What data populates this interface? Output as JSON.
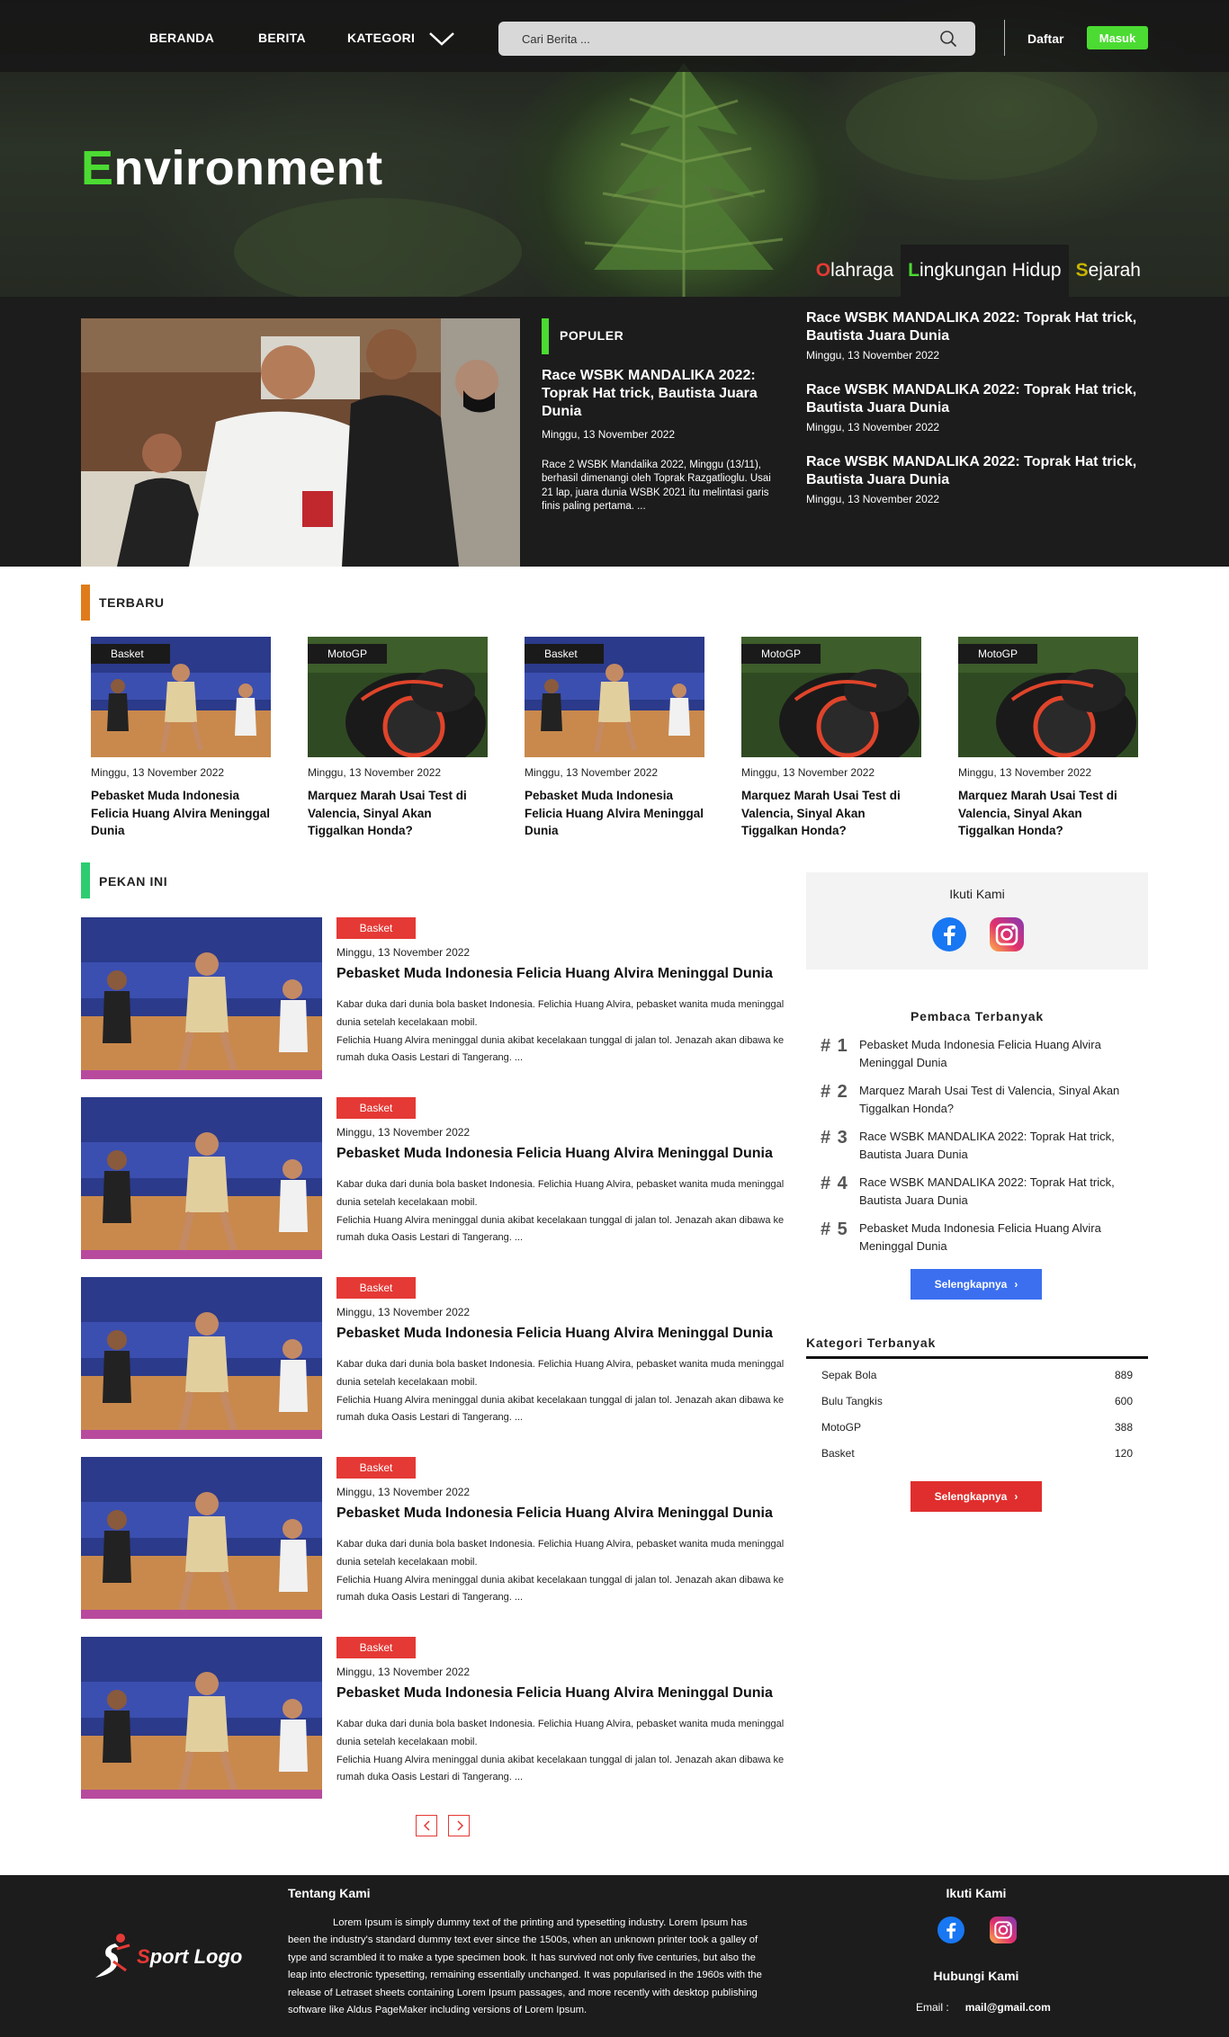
{
  "nav": {
    "home": "BERANDA",
    "news": "BERITA",
    "category": "KATEGORI",
    "search_placeholder": "Cari Berita ...",
    "register": "Daftar",
    "login": "Masuk"
  },
  "hero": {
    "title_first": "E",
    "title_rest": "nvironment",
    "tabs": [
      {
        "first": "O",
        "rest": "lahraga",
        "color": "#e53935"
      },
      {
        "first": "L",
        "rest": "ingkungan Hidup",
        "color": "#4bdb32"
      },
      {
        "first": "S",
        "rest": "ejarah",
        "color": "#c8b400"
      }
    ]
  },
  "popular": {
    "label": "POPULER",
    "title": "Race WSBK MANDALIKA 2022: Toprak Hat trick, Bautista Juara Dunia",
    "date": "Minggu, 13 November 2022",
    "excerpt": "Race 2 WSBK Mandalika 2022, Minggu (13/11), berhasil dimenangi oleh Toprak Razgatlioglu. Usai 21 lap, juara dunia WSBK 2021 itu melintasi garis finis paling pertama. ...",
    "side": [
      {
        "title": "Race WSBK MANDALIKA 2022: Toprak Hat trick, Bautista Juara Dunia",
        "date": "Minggu, 13 November 2022"
      },
      {
        "title": "Race WSBK MANDALIKA 2022: Toprak Hat trick, Bautista Juara Dunia",
        "date": "Minggu, 13 November 2022"
      },
      {
        "title": "Race WSBK MANDALIKA 2022: Toprak Hat trick, Bautista Juara Dunia",
        "date": "Minggu, 13 November 2022"
      }
    ]
  },
  "latest": {
    "label": "TERBARU",
    "cards": [
      {
        "badge": "Basket",
        "date": "Minggu, 13 November 2022",
        "title": "Pebasket Muda Indonesia Felicia Huang Alvira Meninggal Dunia"
      },
      {
        "badge": "MotoGP",
        "date": "Minggu, 13 November 2022",
        "title": "Marquez Marah Usai Test di Valencia, Sinyal Akan Tiggalkan Honda?"
      },
      {
        "badge": "Basket",
        "date": "Minggu, 13 November 2022",
        "title": "Pebasket Muda Indonesia Felicia Huang Alvira Meninggal Dunia"
      },
      {
        "badge": "MotoGP",
        "date": "Minggu, 13 November 2022",
        "title": "Marquez Marah Usai Test di Valencia, Sinyal Akan Tiggalkan Honda?"
      },
      {
        "badge": "MotoGP",
        "date": "Minggu, 13 November 2022",
        "title": "Marquez Marah Usai Test di Valencia, Sinyal Akan Tiggalkan Honda?"
      }
    ]
  },
  "week": {
    "label": "PEKAN INI",
    "items": [
      {
        "badge": "Basket",
        "date": "Minggu, 13 November 2022",
        "title": "Pebasket Muda Indonesia Felicia Huang Alvira Meninggal Dunia",
        "text1": "Kabar duka dari dunia bola basket Indonesia. Felichia Huang Alvira, pebasket wanita muda meninggal dunia setelah kecelakaan mobil.",
        "text2": "Felichia Huang Alvira meninggal dunia akibat kecelakaan tunggal di jalan tol. Jenazah akan dibawa ke rumah duka Oasis Lestari di Tangerang. ..."
      },
      {
        "badge": "Basket",
        "date": "Minggu, 13 November 2022",
        "title": "Pebasket Muda Indonesia Felicia Huang Alvira Meninggal Dunia",
        "text1": "Kabar duka dari dunia bola basket Indonesia. Felichia Huang Alvira, pebasket wanita muda meninggal dunia setelah kecelakaan mobil.",
        "text2": "Felichia Huang Alvira meninggal dunia akibat kecelakaan tunggal di jalan tol. Jenazah akan dibawa ke rumah duka Oasis Lestari di Tangerang. ..."
      },
      {
        "badge": "Basket",
        "date": "Minggu, 13 November 2022",
        "title": "Pebasket Muda Indonesia Felicia Huang Alvira Meninggal Dunia",
        "text1": "Kabar duka dari dunia bola basket Indonesia. Felichia Huang Alvira, pebasket wanita muda meninggal dunia setelah kecelakaan mobil.",
        "text2": "Felichia Huang Alvira meninggal dunia akibat kecelakaan tunggal di jalan tol. Jenazah akan dibawa ke rumah duka Oasis Lestari di Tangerang. ..."
      },
      {
        "badge": "Basket",
        "date": "Minggu, 13 November 2022",
        "title": "Pebasket Muda Indonesia Felicia Huang Alvira Meninggal Dunia",
        "text1": "Kabar duka dari dunia bola basket Indonesia. Felichia Huang Alvira, pebasket wanita muda meninggal dunia setelah kecelakaan mobil.",
        "text2": "Felichia Huang Alvira meninggal dunia akibat kecelakaan tunggal di jalan tol. Jenazah akan dibawa ke rumah duka Oasis Lestari di Tangerang. ..."
      },
      {
        "badge": "Basket",
        "date": "Minggu, 13 November 2022",
        "title": "Pebasket Muda Indonesia Felicia Huang Alvira Meninggal Dunia",
        "text1": "Kabar duka dari dunia bola basket Indonesia. Felichia Huang Alvira, pebasket wanita muda meninggal dunia setelah kecelakaan mobil.",
        "text2": "Felichia Huang Alvira meninggal dunia akibat kecelakaan tunggal di jalan tol. Jenazah akan dibawa ke rumah duka Oasis Lestari di Tangerang. ..."
      }
    ]
  },
  "sidebar": {
    "follow_title": "Ikuti Kami",
    "most_read_title": "Pembaca Terbanyak",
    "most_read": [
      {
        "rank": "# 1",
        "title": "Pebasket Muda Indonesia Felicia Huang Alvira Meninggal Dunia"
      },
      {
        "rank": "# 2",
        "title": "Marquez Marah Usai Test di Valencia, Sinyal Akan Tiggalkan Honda?"
      },
      {
        "rank": "# 3",
        "title": "Race WSBK MANDALIKA 2022: Toprak Hat trick, Bautista Juara Dunia"
      },
      {
        "rank": "# 4",
        "title": "Race WSBK MANDALIKA 2022: Toprak Hat trick, Bautista Juara Dunia"
      },
      {
        "rank": "# 5",
        "title": "Pebasket Muda Indonesia Felicia Huang Alvira Meninggal Dunia"
      }
    ],
    "more_label": "Selengkapnya",
    "category_title": "Kategori Terbanyak",
    "categories": [
      {
        "name": "Sepak Bola",
        "count": "889"
      },
      {
        "name": "Bulu Tangkis",
        "count": "600"
      },
      {
        "name": "MotoGP",
        "count": "388"
      },
      {
        "name": "Basket",
        "count": "120"
      }
    ]
  },
  "footer": {
    "logo_first": "S",
    "logo_rest": "port Logo",
    "about_title": "Tentang Kami",
    "about_text": "Lorem Ipsum is simply dummy text of the printing and typesetting industry. Lorem Ipsum has been the industry's standard dummy text ever since the 1500s, when an unknown printer took a galley of type and scrambled it to make a type specimen book. It has survived not only five centuries, but also the leap into electronic typesetting, remaining essentially unchanged. It was popularised in the 1960s with the release of Letraset sheets containing Lorem Ipsum passages, and more recently with desktop publishing software like Aldus PageMaker including versions of Lorem Ipsum.",
    "follow_title": "Ikuti Kami",
    "contact_title": "Hubungi Kami",
    "email_label": "Email :",
    "email_value": "mail@gmail.com"
  },
  "colors": {
    "accent_green": "#4bdb32",
    "accent_red": "#e53935",
    "accent_orange": "#e07b1a",
    "accent_blue": "#3b6ff0",
    "dark_bg": "#1c1c1c"
  }
}
